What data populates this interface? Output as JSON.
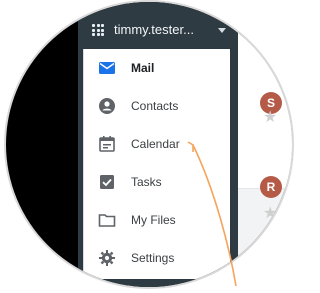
{
  "account": {
    "name": "timmy.tester..."
  },
  "menu": {
    "items": [
      {
        "label": "Mail",
        "icon": "mail-icon",
        "active": true
      },
      {
        "label": "Contacts",
        "icon": "contacts-icon",
        "active": false
      },
      {
        "label": "Calendar",
        "icon": "calendar-icon",
        "active": false
      },
      {
        "label": "Tasks",
        "icon": "tasks-icon",
        "active": false
      },
      {
        "label": "My Files",
        "icon": "folder-icon",
        "active": false
      },
      {
        "label": "Settings",
        "icon": "gear-icon",
        "active": false
      }
    ]
  },
  "background_list": {
    "avatars": [
      {
        "letter": "S",
        "color": "#b55a47"
      },
      {
        "letter": "R",
        "color": "#b55a47"
      }
    ]
  },
  "colors": {
    "accent_mail": "#1a73e8",
    "menu_header_bg": "#2f3b43",
    "arrow": "#f5a45b"
  }
}
